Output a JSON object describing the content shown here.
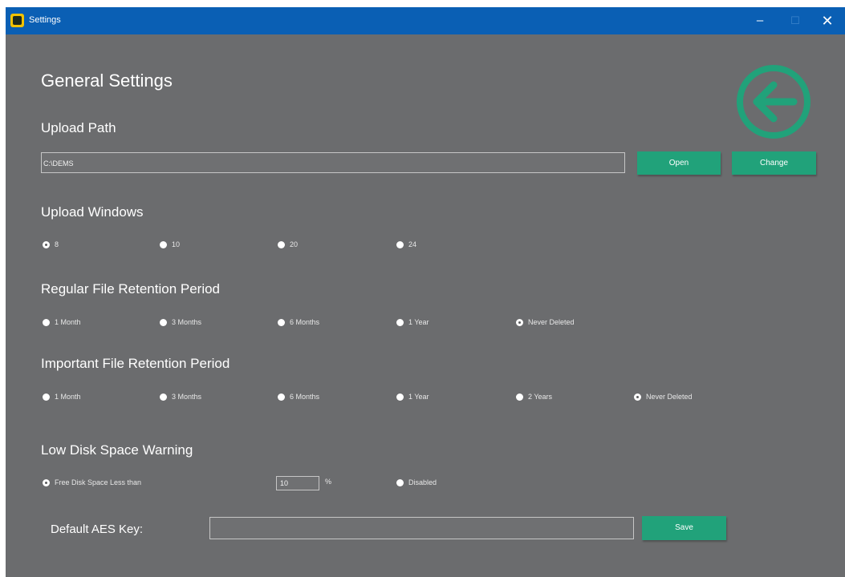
{
  "window": {
    "title": "Settings",
    "minimize_glyph": "‒",
    "maximize_glyph": "☐",
    "close_glyph": "✕"
  },
  "heading": "General Settings",
  "upload_path": {
    "label": "Upload Path",
    "value": "C:\\DEMS",
    "open_label": "Open",
    "change_label": "Change"
  },
  "upload_windows": {
    "label": "Upload Windows",
    "options": [
      "8",
      "10",
      "20",
      "24"
    ],
    "selected": "8"
  },
  "regular_retention": {
    "label": "Regular File Retention Period",
    "options": [
      "1 Month",
      "3 Months",
      "6 Months",
      "1 Year",
      "Never Deleted"
    ],
    "selected": "Never Deleted"
  },
  "important_retention": {
    "label": "Important File Retention Period",
    "options": [
      "1 Month",
      "3 Months",
      "6 Months",
      "1 Year",
      "2 Years",
      "Never Deleted"
    ],
    "selected": "Never Deleted"
  },
  "low_disk": {
    "label": "Low Disk Space Warning",
    "free_space_label": "Free Disk Space Less than",
    "threshold_value": "10",
    "percent_sign": "%",
    "disabled_label": "Disabled",
    "selected": "Free Disk Space Less than"
  },
  "aes": {
    "label": "Default AES Key:",
    "value": "",
    "save_label": "Save"
  },
  "icons": {
    "back": "back-arrow-circle-icon",
    "app": "app-logo-icon"
  },
  "colors": {
    "titlebar": "#0a5fb4",
    "background": "#6b6c6e",
    "accent": "#21a27a"
  }
}
